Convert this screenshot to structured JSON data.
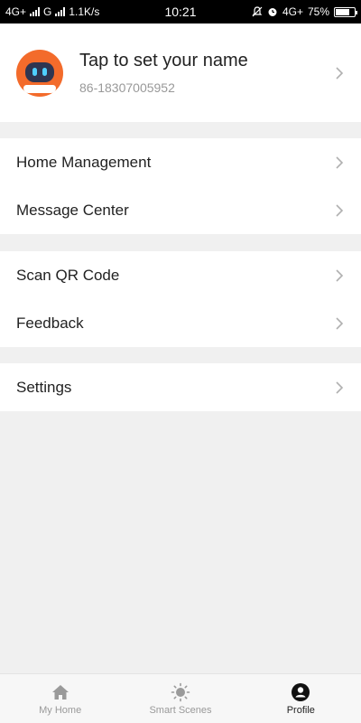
{
  "status_bar": {
    "network1": "4G+",
    "network2": "G",
    "speed": "1.1K/s",
    "time": "10:21",
    "network3": "4G+",
    "battery": "75%",
    "battery_level": 0.75
  },
  "profile": {
    "name": "Tap to set your name",
    "phone": "86-18307005952"
  },
  "menu": {
    "home_management": "Home Management",
    "message_center": "Message Center",
    "scan_qr_code": "Scan QR Code",
    "feedback": "Feedback",
    "settings": "Settings"
  },
  "tabs": {
    "my_home": "My Home",
    "smart_scenes": "Smart Scenes",
    "profile": "Profile"
  },
  "colors": {
    "avatar": "#f36b2b",
    "background": "#f0f0f0",
    "active_tab": "#222222",
    "inactive_tab": "#999999"
  }
}
